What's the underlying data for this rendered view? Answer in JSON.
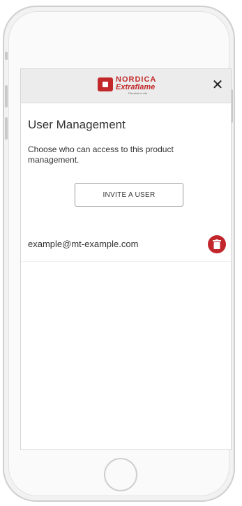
{
  "header": {
    "logo_top": "NORDICA",
    "logo_bottom": "Extraflame",
    "logo_tagline": "Riscalda la vita."
  },
  "page": {
    "title": "User Management",
    "description": "Choose who can access to this product management."
  },
  "invite": {
    "label": "INVITE A USER"
  },
  "users": [
    {
      "email": "example@mt-example.com"
    }
  ],
  "colors": {
    "brand_red": "#c3292b",
    "delete_red": "#c0262b",
    "header_bg": "#ececec"
  },
  "icons": {
    "close": "close-icon",
    "delete": "trash-icon"
  }
}
